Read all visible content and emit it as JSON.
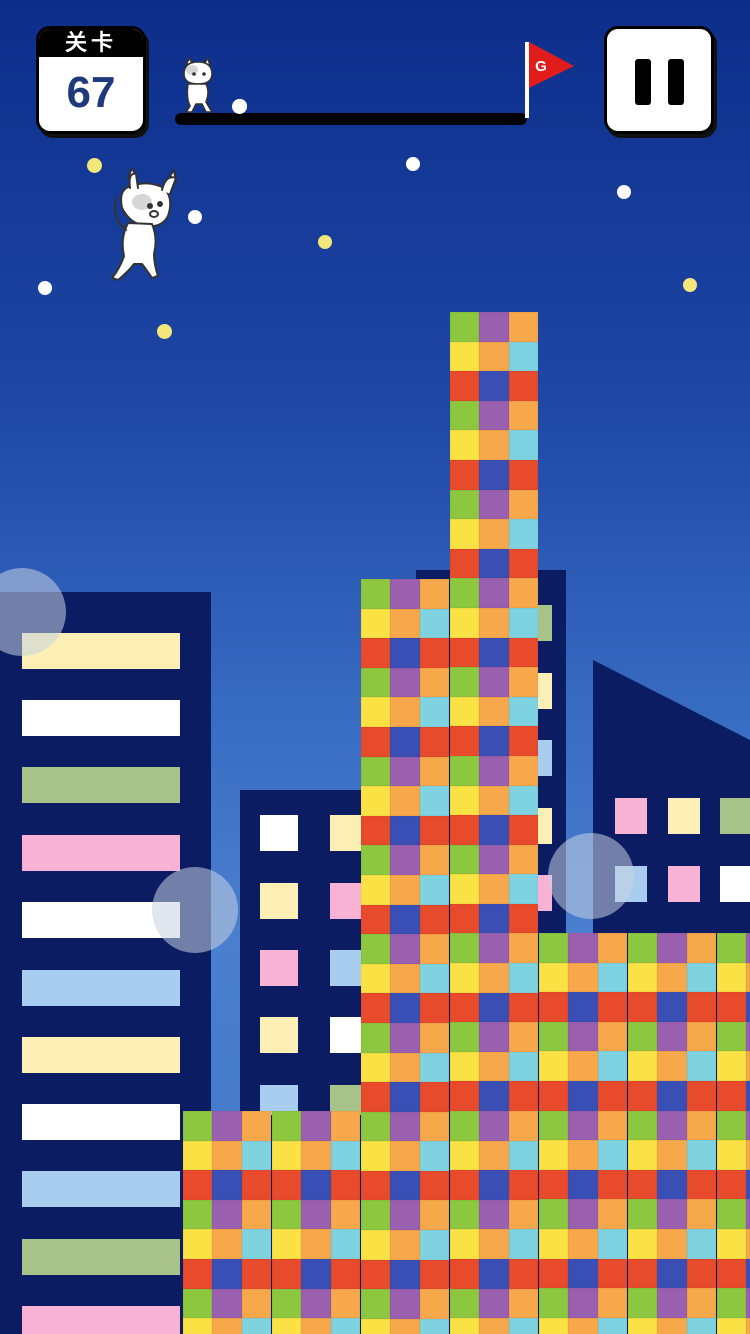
{
  "hud": {
    "level_label": "关卡",
    "level_number": "67",
    "goal_flag_letter": "G"
  },
  "progress": {
    "value": 0.17
  },
  "colors": {
    "sky_top": "#0d2d8a",
    "sky_bottom": "#4a7fcf",
    "building": "#0b1c63",
    "block_palette": [
      "#8dc63f",
      "#9b5fb0",
      "#f7a84a",
      "#fbe244",
      "#f7a84a",
      "#7fd3e0",
      "#e84a2c",
      "#3a4fb5",
      "#e84a2c"
    ],
    "flag": "#e21b1b"
  },
  "icons": [
    "cat-icon",
    "flag-icon",
    "pause-icon"
  ]
}
